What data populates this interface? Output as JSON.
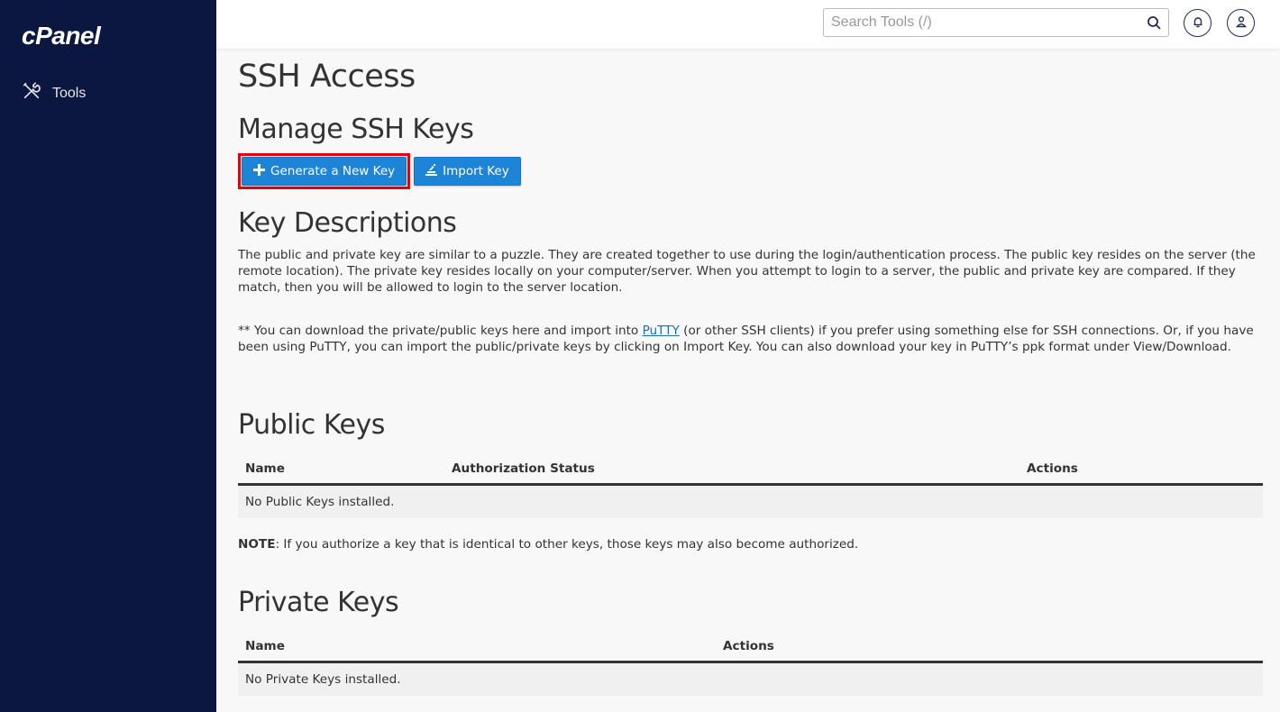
{
  "sidebar": {
    "logo": "cPanel",
    "items": [
      {
        "label": "Tools",
        "icon": "tools-icon"
      }
    ]
  },
  "topbar": {
    "search_placeholder": "Search Tools (/)",
    "search_value": "",
    "icons": [
      "search-icon",
      "bell-icon",
      "user-icon"
    ]
  },
  "page": {
    "title": "SSH Access",
    "manage_heading": "Manage SSH Keys",
    "buttons": {
      "generate": "Generate a New Key",
      "import": "Import Key"
    },
    "key_desc_heading": "Key Descriptions",
    "key_desc_text": "The public and private key are similar to a puzzle. They are created together to use during the login/authentication process. The public key resides on the server (the remote location). The private key resides locally on your computer/server. When you attempt to login to a server, the public and private key are compared. If they match, then you will be allowed to login to the server location.",
    "putty_text_before": "** You can download the private/public keys here and import into ",
    "putty_link": "PuTTY",
    "putty_text_after": " (or other SSH clients) if you prefer using something else for SSH connections. Or, if you have been using PuTTY, you can import the public/private keys by clicking on Import Key. You can also download your key in PuTTY’s ppk format under View/Download."
  },
  "public_keys": {
    "heading": "Public Keys",
    "columns": [
      "Name",
      "Authorization Status",
      "Actions"
    ],
    "empty_text": "No Public Keys installed.",
    "note_label": "NOTE",
    "note_text": ": If you authorize a key that is identical to other keys, those keys may also become authorized."
  },
  "private_keys": {
    "heading": "Private Keys",
    "columns": [
      "Name",
      "Actions"
    ],
    "empty_text": "No Private Keys installed."
  }
}
